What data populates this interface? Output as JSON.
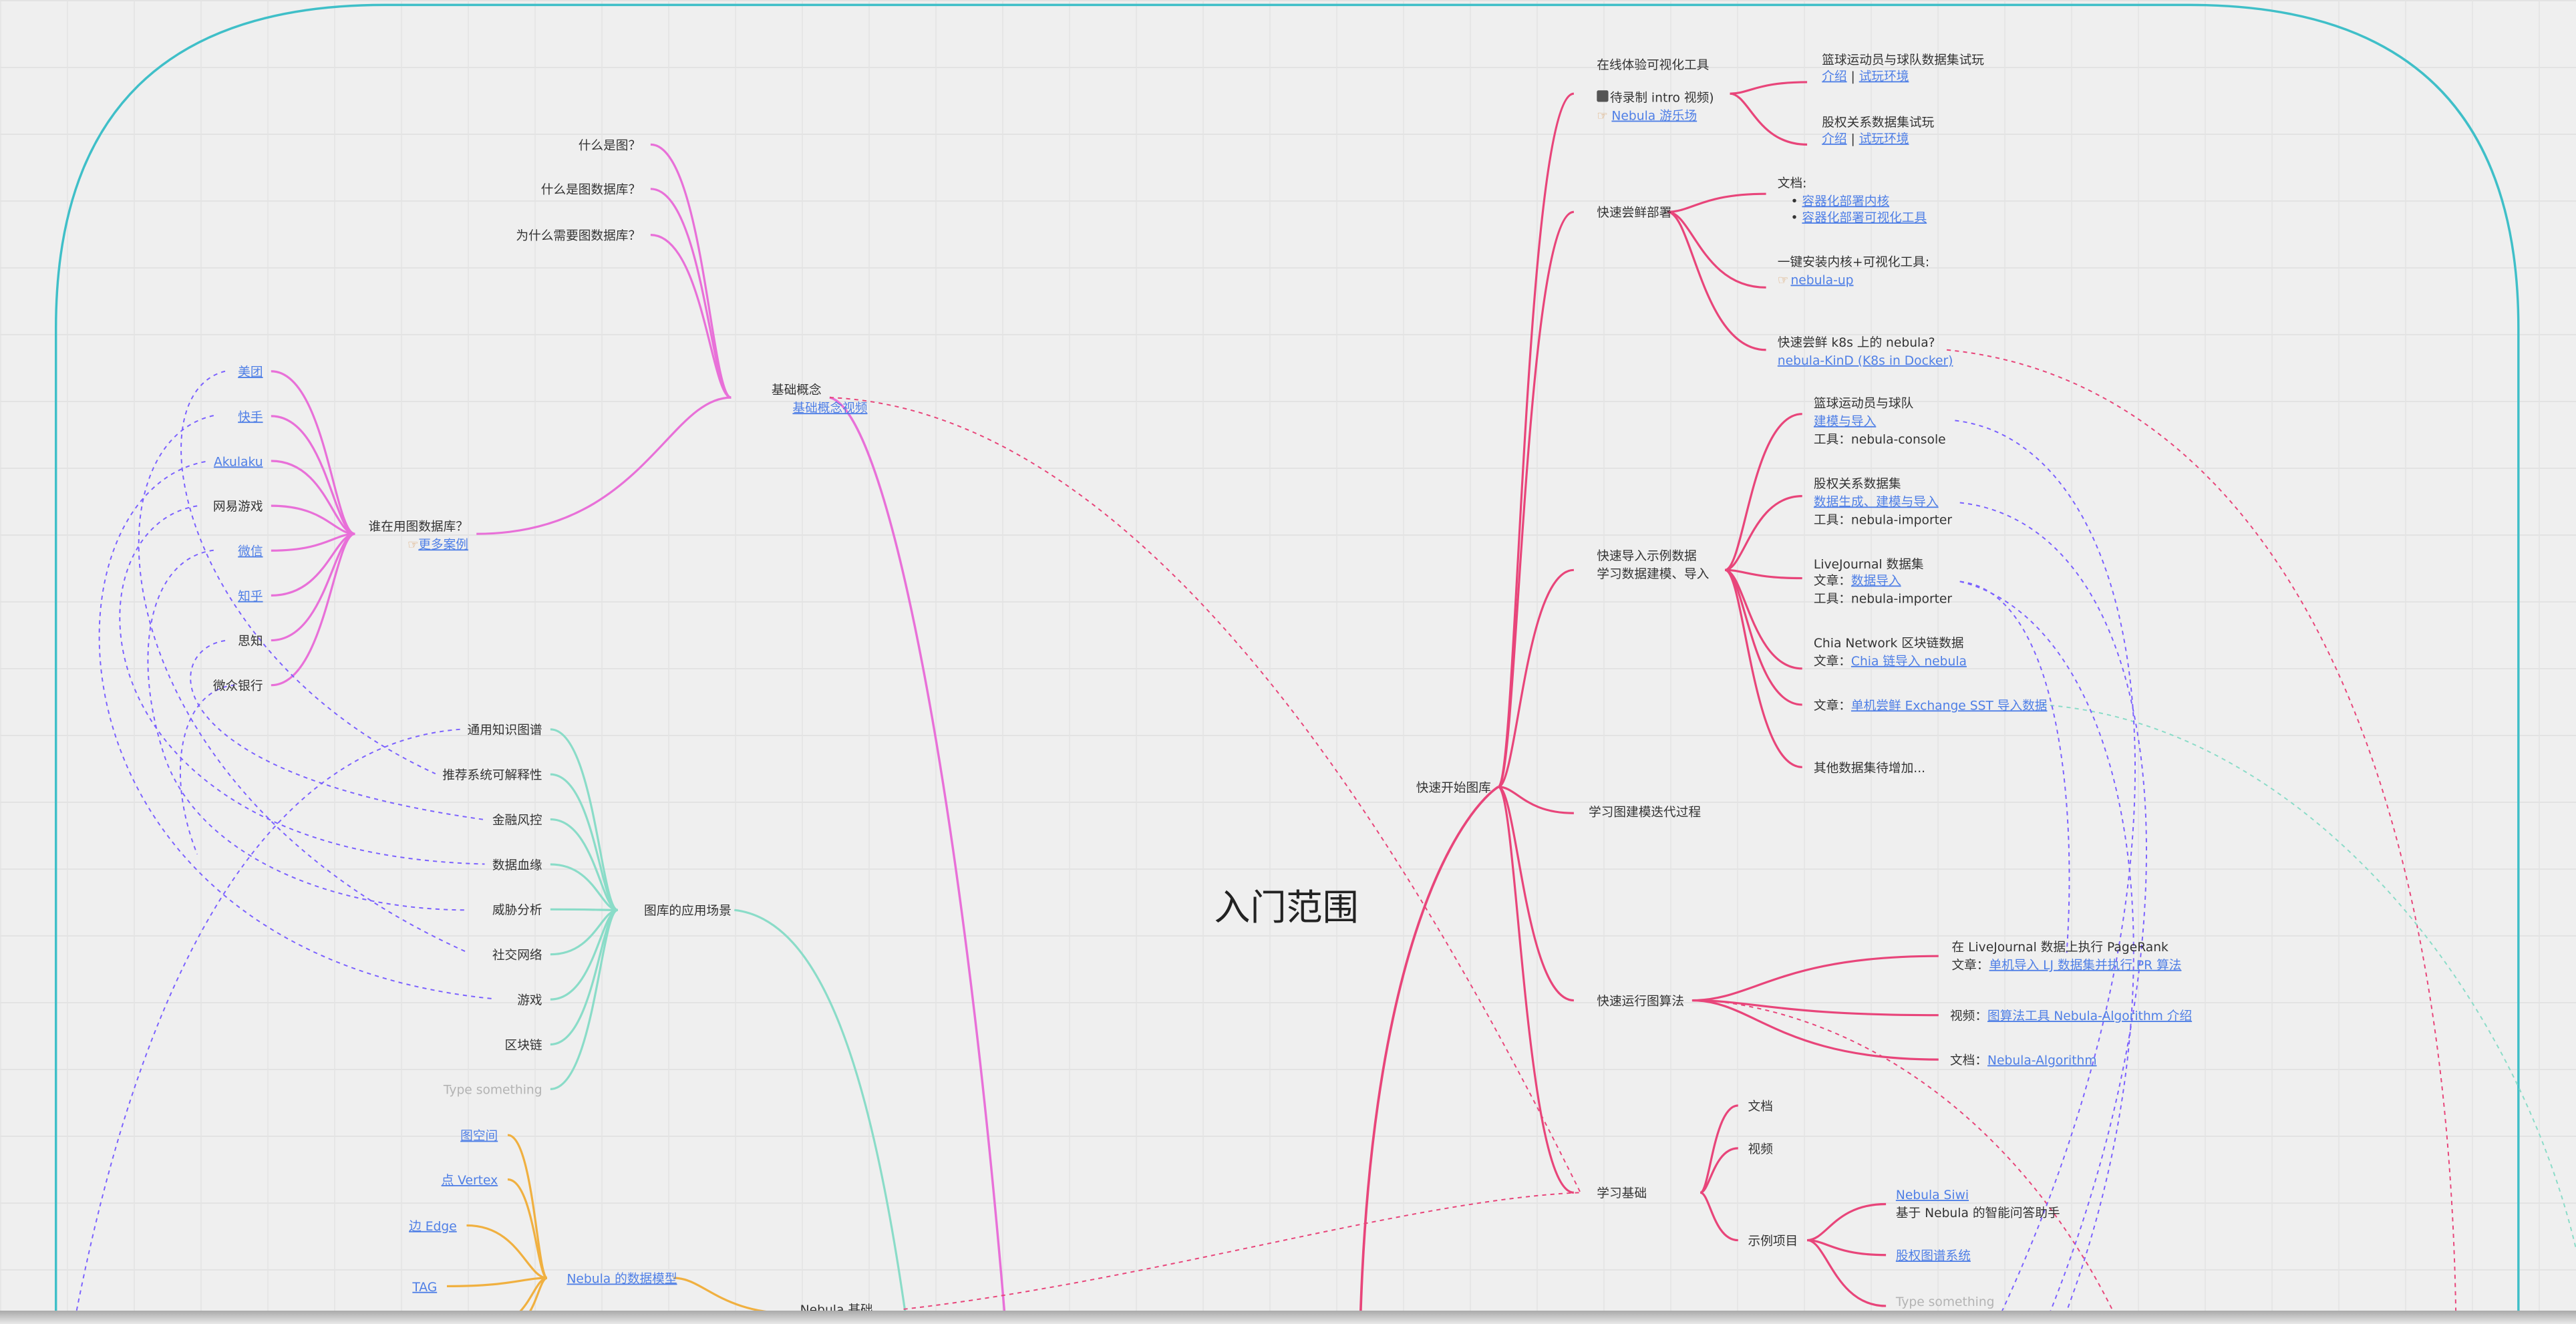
{
  "center": "入门范围",
  "colors": {
    "quick_start": "#e8457a",
    "basics": "#e870d8",
    "scenarios": "#8adcc8",
    "data_model": "#f0b040",
    "cross_link": "#7b61ff",
    "frame": "#3fbfc8",
    "link": "#4f7fe6"
  },
  "icons": {
    "tv": "tv-icon",
    "hand": "pointing-hand-icon"
  },
  "quick_start": {
    "title": "快速开始图库",
    "online": {
      "title": "在线体验可视化工具",
      "video_note": "待录制 intro 视频)",
      "playground": "Nebula 游乐场",
      "basketball": {
        "title": "篮球运动员与球队数据集试玩",
        "intro": "介绍",
        "sep": " | ",
        "try": "试玩环境"
      },
      "equity": {
        "title": "股权关系数据集试玩",
        "intro": "介绍",
        "sep": " | ",
        "try": "试玩环境"
      }
    },
    "deploy": {
      "title": "快速尝鲜部署",
      "docs_label": "文档:",
      "docs": [
        "容器化部署内核",
        "容器化部署可视化工具"
      ],
      "one_click": "一键安装内核+可视化工具:",
      "nebula_up": "nebula-up",
      "k8s_q": "快速尝鲜 k8s 上的 nebula?",
      "kind": "nebula-KinD (K8s in Docker)"
    },
    "import": {
      "title": "快速导入示例数据",
      "subtitle": "学习数据建模、导入",
      "basketball": {
        "title": "篮球运动员与球队",
        "link": "建模与导入",
        "tool": "工具：nebula-console"
      },
      "equity": {
        "title": "股权关系数据集",
        "link": "数据生成、建模与导入",
        "tool": "工具：nebula-importer"
      },
      "livejournal": {
        "title": "LiveJournal 数据集",
        "article": "文章：",
        "link": "数据导入",
        "tool": "工具：nebula-importer"
      },
      "chia": {
        "title": "Chia Network 区块链数据",
        "article": "文章：",
        "link": "Chia 链导入 nebula"
      },
      "exchange": {
        "article": "文章：",
        "link": "单机尝鲜 Exchange SST 导入数据"
      },
      "more": "其他数据集待增加..."
    },
    "modeling": "学习图建模迭代过程",
    "algo": {
      "title": "快速运行图算法",
      "pagerank": "在 LiveJournal 数据上执行 PageRank",
      "article": "文章：",
      "pagerank_link": "单机导入 LJ 数据集并执行 PR 算法",
      "video": "视频：",
      "video_link": "图算法工具 Nebula-Algorithm 介绍",
      "doc": "文档：",
      "doc_link": "Nebula-Algorithm"
    },
    "learn": {
      "title": "学习基础",
      "docs": "文档",
      "video": "视频",
      "examples": "示例项目",
      "siwi": "Nebula Siwi",
      "siwi_desc": "基于 Nebula 的智能问答助手",
      "equity_graph": "股权图谱系统",
      "placeholder": "Type something"
    }
  },
  "basics": {
    "title": "基础概念",
    "video": "基础概念视频",
    "questions": [
      "什么是图？",
      "什么是图数据库？",
      "为什么需要图数据库？"
    ],
    "users": {
      "title": "谁在用图数据库？",
      "more": "更多案例",
      "items": [
        {
          "label": "美团",
          "link": true
        },
        {
          "label": "快手",
          "link": true
        },
        {
          "label": "Akulaku",
          "link": true
        },
        {
          "label": "网易游戏",
          "link": false
        },
        {
          "label": "微信",
          "link": true
        },
        {
          "label": "知乎",
          "link": true
        },
        {
          "label": "思知",
          "link": false
        },
        {
          "label": "微众银行",
          "link": false
        }
      ]
    }
  },
  "scenarios": {
    "title": "图库的应用场景",
    "items": [
      "通用知识图谱",
      "推荐系统可解释性",
      "金融风控",
      "数据血缘",
      "威胁分析",
      "社交网络",
      "游戏",
      "区块链"
    ],
    "placeholder": "Type something"
  },
  "nebula_basics": {
    "title": "Nebula 基础",
    "data_model": {
      "title": "Nebula 的数据模型",
      "items": [
        "图空间",
        "点 Vertex",
        "边 Edge",
        "TAG"
      ]
    }
  }
}
